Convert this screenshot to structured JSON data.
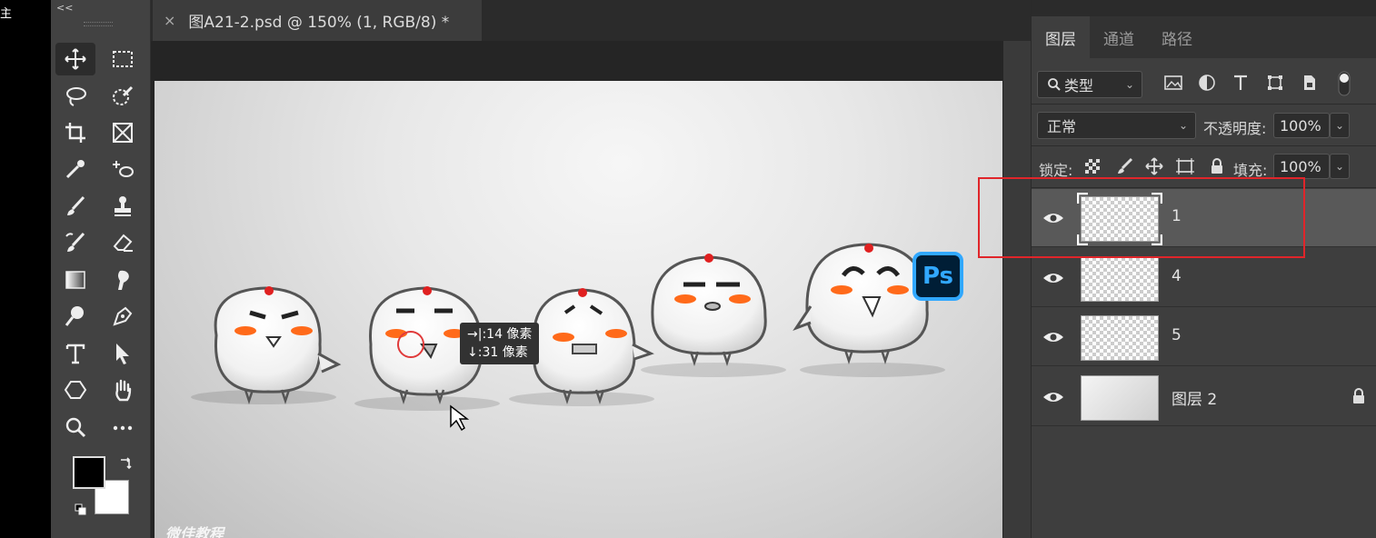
{
  "left_strip": {
    "text": "主"
  },
  "toolbar": {
    "collapse_glyph": "<<",
    "tools": [
      "move-tool",
      "marquee-tool",
      "lasso-tool",
      "quick-select-tool",
      "crop-tool",
      "frame-tool",
      "eyedropper-tool",
      "spot-heal-tool",
      "brush-tool",
      "stamp-tool",
      "history-brush-tool",
      "eraser-tool",
      "gradient-tool",
      "smudge-tool",
      "dodge-tool",
      "pen-tool",
      "type-tool",
      "path-select-tool",
      "shape-tool",
      "hand-tool",
      "zoom-tool",
      "more-tools"
    ],
    "foreground_color": "#000000",
    "background_color": "#ffffff"
  },
  "document": {
    "tab_title": "图A21-2.psd @ 150% (1, RGB/8) *",
    "close_glyph": "×"
  },
  "canvas": {
    "tooltip_line1": "→|:14 像素",
    "tooltip_line2": "↓:31 像素",
    "logo_text": "Ps",
    "watermark": "微佳教程"
  },
  "panel": {
    "tabs": [
      "图层",
      "通道",
      "路径"
    ],
    "active_tab": "图层",
    "filter_label": "类型",
    "blend_mode": "正常",
    "opacity_label": "不透明度:",
    "opacity_value": "100%",
    "lock_label": "锁定:",
    "fill_label": "填充:",
    "fill_value": "100%",
    "layers": [
      {
        "name": "1",
        "selected": true,
        "locked": false
      },
      {
        "name": "4",
        "selected": false,
        "locked": false
      },
      {
        "name": "5",
        "selected": false,
        "locked": false
      },
      {
        "name": "图层 2",
        "selected": false,
        "locked": true
      }
    ]
  },
  "colors": {
    "highlight_box": "#e0252a",
    "ps_blue": "#31a8ff",
    "ps_dark": "#001e36"
  }
}
